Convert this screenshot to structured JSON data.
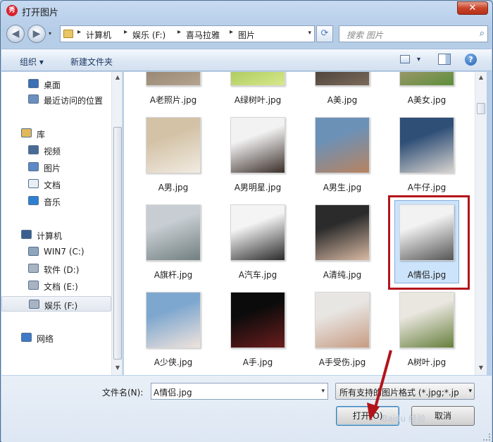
{
  "window": {
    "title": "打开图片",
    "app_icon_text": "秀",
    "close_glyph": "✕"
  },
  "nav": {
    "back_glyph": "◀",
    "forward_glyph": "▶",
    "history_glyph": "▾",
    "breadcrumb": [
      "计算机",
      "娱乐 (F:)",
      "喜马拉雅",
      "图片"
    ],
    "breadcrumb_sep": "▸",
    "address_drop_glyph": "▾",
    "refresh_glyph": "⟳",
    "search_placeholder": "搜索 图片",
    "search_icon": "search-icon",
    "search_glyph": "⌕"
  },
  "toolbar": {
    "organize": "组织 ▾",
    "new_folder": "新建文件夹",
    "view_drop_glyph": "▾",
    "help_glyph": "?"
  },
  "sidebar": {
    "items": [
      {
        "label": "桌面",
        "icon": "desktop-icon",
        "color": "#3b6fb6"
      },
      {
        "label": "最近访问的位置",
        "icon": "recent-places-icon",
        "color": "#6b8fbf"
      },
      {
        "label": "库",
        "icon": "library-icon",
        "color": "#e2b85a"
      },
      {
        "label": "视频",
        "icon": "video-library-icon",
        "color": "#4a6b95"
      },
      {
        "label": "图片",
        "icon": "pictures-library-icon",
        "color": "#5b8ac4"
      },
      {
        "label": "文档",
        "icon": "documents-library-icon",
        "color": "#e9eef5"
      },
      {
        "label": "音乐",
        "icon": "music-library-icon",
        "color": "#2f7fd0"
      },
      {
        "label": "计算机",
        "icon": "computer-icon",
        "color": "#3a5f8f"
      },
      {
        "label": "WIN7 (C:)",
        "icon": "system-drive-icon",
        "color": "#8fa4bd"
      },
      {
        "label": "软件 (D:)",
        "icon": "drive-icon",
        "color": "#a9b4c2"
      },
      {
        "label": "文档 (E:)",
        "icon": "drive-icon",
        "color": "#a9b4c2"
      },
      {
        "label": "娱乐 (F:)",
        "icon": "drive-icon",
        "color": "#a9b4c2"
      },
      {
        "label": "网络",
        "icon": "network-icon",
        "color": "#3f79c7"
      }
    ],
    "selected": "娱乐 (F:)"
  },
  "files": [
    {
      "name": "A老照片.jpg",
      "colors": [
        "#8a7b6a",
        "#b5a48e"
      ]
    },
    {
      "name": "A绿树叶.jpg",
      "colors": [
        "#9cbf4b",
        "#d7e88c"
      ]
    },
    {
      "name": "A美.jpg",
      "colors": [
        "#3a3431",
        "#7c6a5a"
      ]
    },
    {
      "name": "A美女.jpg",
      "colors": [
        "#b59a7e",
        "#5d8f3a"
      ]
    },
    {
      "name": "A男.jpg",
      "colors": [
        "#d3c2a6",
        "#f1ebe1"
      ]
    },
    {
      "name": "A男明星.jpg",
      "colors": [
        "#f2f2f2",
        "#3b2f2a"
      ]
    },
    {
      "name": "A男生.jpg",
      "colors": [
        "#6c91b7",
        "#b8835f"
      ]
    },
    {
      "name": "A牛仔.jpg",
      "colors": [
        "#2f4f77",
        "#d9d4cf"
      ]
    },
    {
      "name": "A旗杆.jpg",
      "colors": [
        "#c7cdd2",
        "#717f80"
      ]
    },
    {
      "name": "A汽车.jpg",
      "colors": [
        "#f4f4f4",
        "#2a2a2a"
      ]
    },
    {
      "name": "A清纯.jpg",
      "colors": [
        "#2b2b2b",
        "#d9b9a3"
      ]
    },
    {
      "name": "A情侣.jpg",
      "colors": [
        "#f2f2f2",
        "#555"
      ]
    },
    {
      "name": "A少侠.jpg",
      "colors": [
        "#7ea7cf",
        "#f0e3dc"
      ]
    },
    {
      "name": "A手.jpg",
      "colors": [
        "#0b0b0b",
        "#6b1d1d"
      ]
    },
    {
      "name": "A手受伤.jpg",
      "colors": [
        "#e8e6e3",
        "#c79b82"
      ]
    },
    {
      "name": "A树叶.jpg",
      "colors": [
        "#eae7e0",
        "#667f3c"
      ]
    }
  ],
  "selected_file": "A情侣.jpg",
  "bottom": {
    "filename_label": "文件名(N):",
    "filename_value": "A情侣.jpg",
    "filename_drop": "▾",
    "filetype_value": "所有支持的图片格式 (*.jpg;*.jp",
    "filetype_drop": "▾",
    "open_label": "打开(O)",
    "cancel_label": "取消"
  },
  "watermark": "Baidu 经验",
  "colors": {
    "highlight": "#b3141b",
    "arrow": "#b3141b"
  }
}
